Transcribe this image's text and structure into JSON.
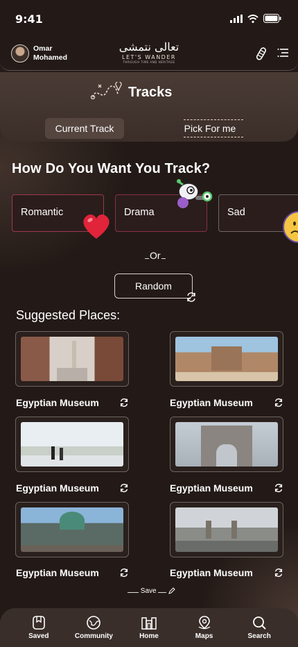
{
  "status": {
    "time": "9:41"
  },
  "header": {
    "user_name": "Omar Mohamed",
    "logo_script": "تعالى نتمشى",
    "logo_text": "LET'S WANDER",
    "logo_tagline": "THROUGH TIME AND HERITAGE"
  },
  "tracks": {
    "title": "Tracks",
    "tabs": [
      {
        "label": "Current Track"
      },
      {
        "label": "Pick For me"
      }
    ]
  },
  "question": "How Do You Want You Track?",
  "moods": [
    {
      "label": "Romantic"
    },
    {
      "label": "Drama"
    },
    {
      "label": "Sad"
    }
  ],
  "or_label": "Or",
  "random_label": "Random",
  "suggested_title": "Suggested Places:",
  "places": [
    {
      "name": "Egyptian Museum"
    },
    {
      "name": "Egyptian Museum"
    },
    {
      "name": "Egyptian Museum"
    },
    {
      "name": "Egyptian Museum"
    },
    {
      "name": "Egyptian Museum"
    },
    {
      "name": "Egyptian Museum"
    }
  ],
  "save_label": "Save",
  "nav": [
    {
      "label": "Saved"
    },
    {
      "label": "Community"
    },
    {
      "label": "Home"
    },
    {
      "label": "Maps"
    },
    {
      "label": "Search"
    }
  ],
  "colors": {
    "background": "#231a17",
    "panel": "#3b2e29",
    "mood_border": "#8a3a4a",
    "heart": "#e0243a"
  }
}
